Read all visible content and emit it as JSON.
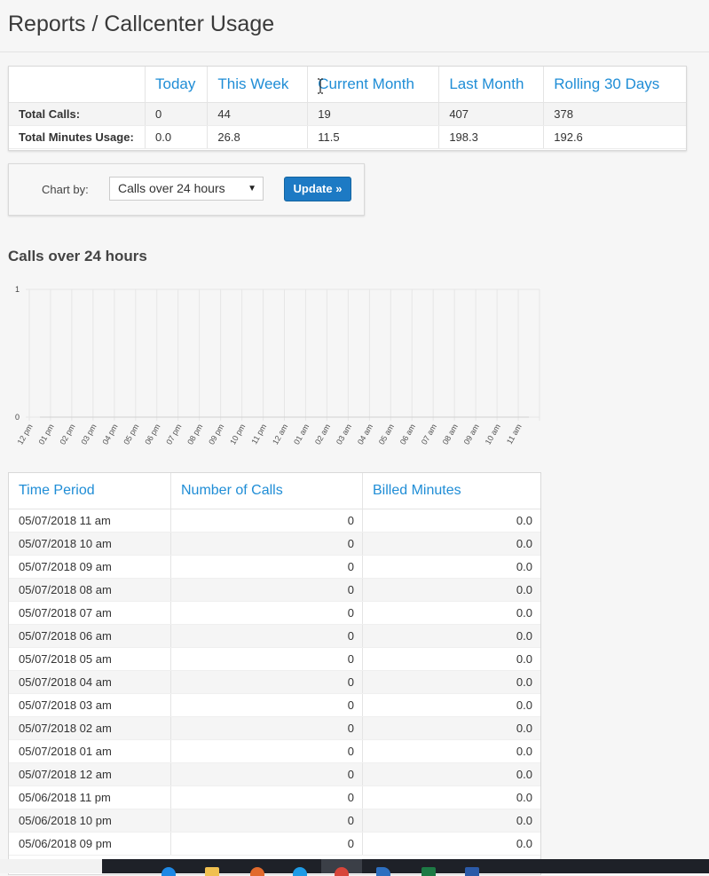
{
  "page": {
    "title": "Reports / Callcenter Usage"
  },
  "summary": {
    "columns": [
      "Today",
      "This Week",
      "Current Month",
      "Last Month",
      "Rolling 30 Days"
    ],
    "rows": [
      {
        "label": "Total Calls:",
        "values": [
          "0",
          "44",
          "19",
          "407",
          "378"
        ]
      },
      {
        "label": "Total Minutes Usage:",
        "values": [
          "0.0",
          "26.8",
          "11.5",
          "198.3",
          "192.6"
        ]
      }
    ]
  },
  "form": {
    "label": "Chart by:",
    "selected": "Calls over 24 hours",
    "button": "Update »"
  },
  "chart_title": "Calls over 24 hours",
  "chart_data": {
    "type": "line",
    "x": [
      "12 pm",
      "01 pm",
      "02 pm",
      "03 pm",
      "04 pm",
      "05 pm",
      "06 pm",
      "07 pm",
      "08 pm",
      "09 pm",
      "10 pm",
      "11 pm",
      "12 am",
      "01 am",
      "02 am",
      "03 am",
      "04 am",
      "05 am",
      "06 am",
      "07 am",
      "08 am",
      "09 am",
      "10 am",
      "11 am"
    ],
    "series": [
      {
        "values": [
          0,
          0,
          0,
          0,
          0,
          0,
          0,
          0,
          0,
          0,
          0,
          0,
          0,
          0,
          0,
          0,
          0,
          0,
          0,
          0,
          0,
          0,
          0,
          0
        ]
      }
    ],
    "yticks": [
      "1",
      "0"
    ],
    "ylim": [
      0,
      1
    ],
    "grid": true,
    "title": "",
    "xlabel": "",
    "ylabel": ""
  },
  "table": {
    "headers": [
      "Time Period",
      "Number of Calls",
      "Billed Minutes"
    ],
    "rows": [
      [
        "05/07/2018 11 am",
        "0",
        "0.0"
      ],
      [
        "05/07/2018 10 am",
        "0",
        "0.0"
      ],
      [
        "05/07/2018 09 am",
        "0",
        "0.0"
      ],
      [
        "05/07/2018 08 am",
        "0",
        "0.0"
      ],
      [
        "05/07/2018 07 am",
        "0",
        "0.0"
      ],
      [
        "05/07/2018 06 am",
        "0",
        "0.0"
      ],
      [
        "05/07/2018 05 am",
        "0",
        "0.0"
      ],
      [
        "05/07/2018 04 am",
        "0",
        "0.0"
      ],
      [
        "05/07/2018 03 am",
        "0",
        "0.0"
      ],
      [
        "05/07/2018 02 am",
        "0",
        "0.0"
      ],
      [
        "05/07/2018 01 am",
        "0",
        "0.0"
      ],
      [
        "05/07/2018 12 am",
        "0",
        "0.0"
      ],
      [
        "05/06/2018 11 pm",
        "0",
        "0.0"
      ],
      [
        "05/06/2018 10 pm",
        "0",
        "0.0"
      ],
      [
        "05/06/2018 09 pm",
        "0",
        "0.0"
      ]
    ]
  }
}
